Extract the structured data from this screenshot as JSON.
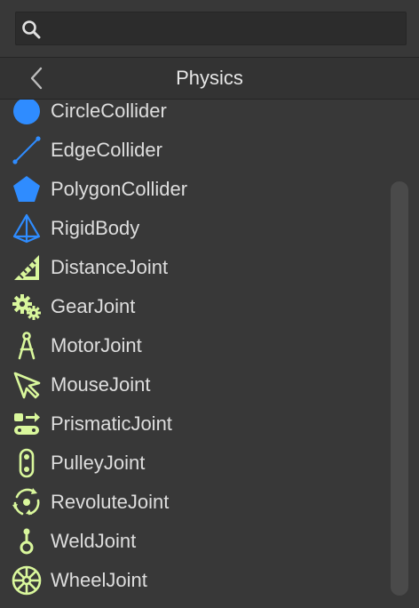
{
  "search": {
    "placeholder": "",
    "value": ""
  },
  "header": {
    "title": "Physics"
  },
  "colors": {
    "collider_blue": "#2f8cff",
    "joint_green": "#d9f79c",
    "text": "#dedede",
    "background": "#383838"
  },
  "items": [
    {
      "label": "CircleCollider",
      "icon": "circle-collider-icon"
    },
    {
      "label": "EdgeCollider",
      "icon": "edge-collider-icon"
    },
    {
      "label": "PolygonCollider",
      "icon": "polygon-collider-icon"
    },
    {
      "label": "RigidBody",
      "icon": "rigidbody-icon"
    },
    {
      "label": "DistanceJoint",
      "icon": "distance-joint-icon"
    },
    {
      "label": "GearJoint",
      "icon": "gear-joint-icon"
    },
    {
      "label": "MotorJoint",
      "icon": "motor-joint-icon"
    },
    {
      "label": "MouseJoint",
      "icon": "mouse-joint-icon"
    },
    {
      "label": "PrismaticJoint",
      "icon": "prismatic-joint-icon"
    },
    {
      "label": "PulleyJoint",
      "icon": "pulley-joint-icon"
    },
    {
      "label": "RevoluteJoint",
      "icon": "revolute-joint-icon"
    },
    {
      "label": "WeldJoint",
      "icon": "weld-joint-icon"
    },
    {
      "label": "WheelJoint",
      "icon": "wheel-joint-icon"
    }
  ]
}
